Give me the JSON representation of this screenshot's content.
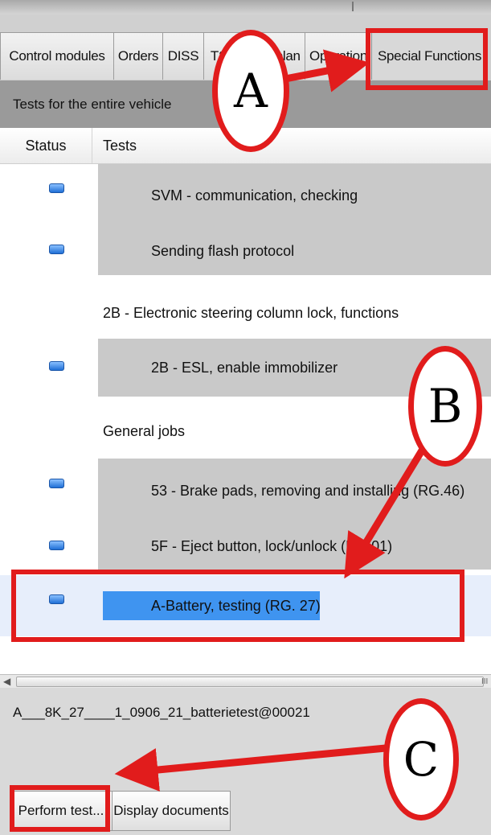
{
  "tabs": [
    {
      "label": "Control modules"
    },
    {
      "label": "Orders"
    },
    {
      "label": "DISS"
    },
    {
      "label": "TSB"
    },
    {
      "label": "Test plan"
    },
    {
      "label": "Operation"
    },
    {
      "label": "Special Functions",
      "active": true
    }
  ],
  "section_title": "Tests for the entire vehicle",
  "table": {
    "headers": {
      "status": "Status",
      "tests": "Tests"
    },
    "rows": [
      {
        "label": "SVM - communication, checking",
        "has_status": true
      },
      {
        "label": "Sending flash protocol",
        "has_status": true
      },
      {
        "label": "2B - Electronic steering column lock, functions",
        "group": true
      },
      {
        "label": "2B - ESL, enable immobilizer",
        "has_status": true
      },
      {
        "label": "General jobs",
        "group": true
      },
      {
        "label": "53 - Brake pads, removing and installing (RG.46)",
        "has_status": true
      },
      {
        "label": "5F - Eject button, lock/unlock (RG 01)",
        "has_status": true
      },
      {
        "label": "A-Battery, testing (RG. 27)",
        "has_status": true,
        "selected": true
      }
    ]
  },
  "scrollbar": {
    "grip": "III"
  },
  "filename": "A___8K_27____1_0906_21_batterietest@00021",
  "buttons": {
    "perform": "Perform test...",
    "documents": "Display documents"
  },
  "callouts": {
    "a": "A",
    "b": "B",
    "c": "C"
  },
  "colors": {
    "callout": "#e11c1c",
    "selection": "#3f94f0",
    "status_icon": "#1f6fd6"
  }
}
